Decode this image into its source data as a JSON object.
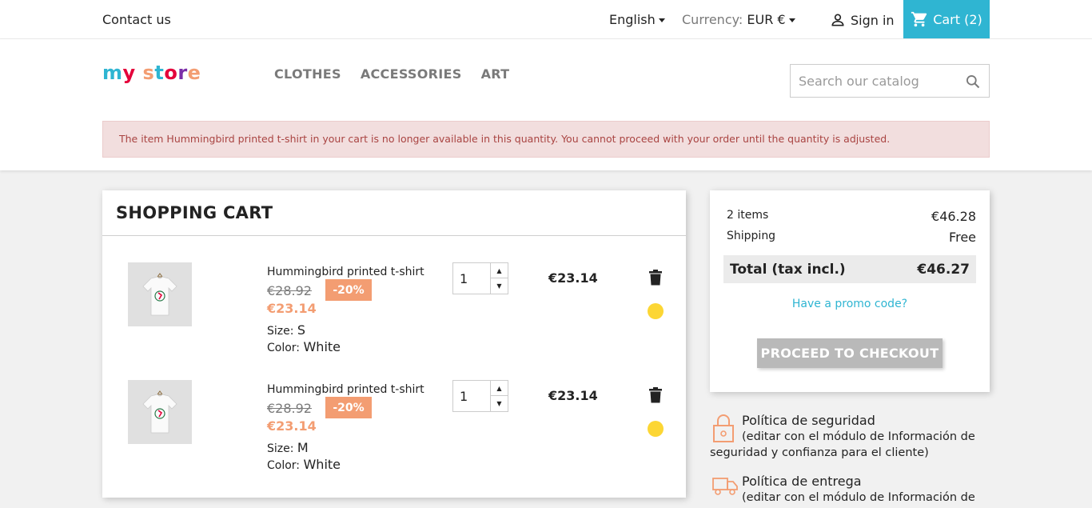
{
  "topnav": {
    "contact": "Contact us",
    "language": "English",
    "currency_label": "Currency:",
    "currency_value": "EUR €",
    "sign_in": "Sign in",
    "cart": "Cart (2)"
  },
  "header": {
    "logo_letters": [
      "m",
      "y",
      " ",
      "s",
      "t",
      "o",
      "r",
      "e"
    ],
    "logo_colors": [
      "#2fb5d2",
      "#e4003a",
      "#000000",
      "#f39d72",
      "#2fb5d2",
      "#e4003a",
      "#7b2ea8",
      "#f39d72"
    ],
    "menu": [
      "CLOTHES",
      "ACCESSORIES",
      "ART"
    ],
    "search_placeholder": "Search our catalog"
  },
  "alert": "The item Hummingbird printed t-shirt in your cart is no longer available in this quantity. You cannot proceed with your order until the quantity is adjusted.",
  "cart": {
    "title": "SHOPPING CART",
    "items": [
      {
        "name": "Hummingbird printed t-shirt",
        "old_price": "€28.92",
        "discount": "-20%",
        "price": "€23.14",
        "size_label": "Size:",
        "size": "S",
        "color_label": "Color:",
        "color": "White",
        "quantity": "1",
        "total": "€23.14"
      },
      {
        "name": "Hummingbird printed t-shirt",
        "old_price": "€28.92",
        "discount": "-20%",
        "price": "€23.14",
        "size_label": "Size:",
        "size": "M",
        "color_label": "Color:",
        "color": "White",
        "quantity": "1",
        "total": "€23.14"
      }
    ]
  },
  "summary": {
    "items_label": "2 items",
    "items_value": "€46.28",
    "shipping_label": "Shipping",
    "shipping_value": "Free",
    "total_label": "Total (tax incl.)",
    "total_value": "€46.27",
    "promo": "Have a promo code?",
    "checkout": "PROCEED TO CHECKOUT"
  },
  "reassurance": [
    {
      "icon": "lock-icon",
      "title": "Política de seguridad",
      "desc": "(editar con el módulo de Información de seguridad y confianza para el cliente)"
    },
    {
      "icon": "truck-icon",
      "title": "Política de entrega",
      "desc": "(editar con el módulo de Información de seguridad y confianza para el cliente)"
    }
  ],
  "colors": {
    "accent": "#2fb5d2",
    "discount": "#f39d72",
    "alert_bg": "#f2dede",
    "alert_text": "#a94442",
    "checkout_disabled": "#b9b9b9",
    "status_dot": "#fcd634"
  }
}
